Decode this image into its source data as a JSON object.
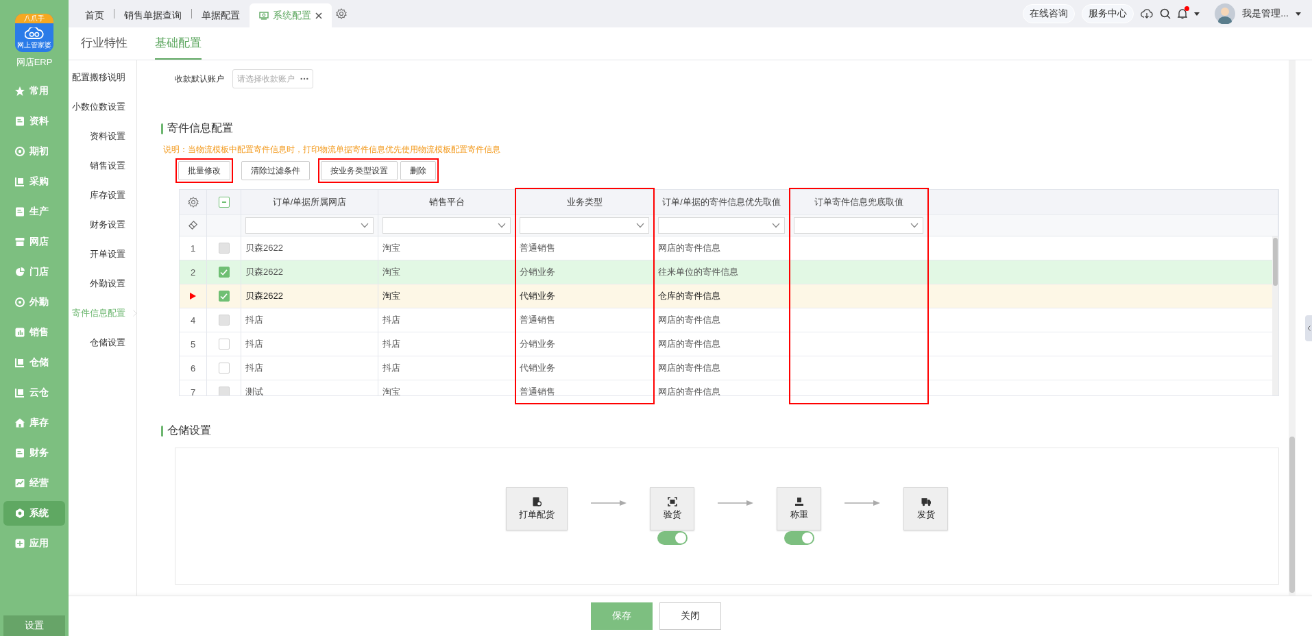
{
  "app": {
    "logo_badge": "八爪手",
    "logo_caption": "网上管家婆",
    "name": "网店ERP"
  },
  "nav": [
    {
      "label": "常用",
      "selected": false
    },
    {
      "label": "资料",
      "selected": false
    },
    {
      "label": "期初",
      "selected": false
    },
    {
      "label": "采购",
      "selected": false
    },
    {
      "label": "生产",
      "selected": false
    },
    {
      "label": "网店",
      "selected": false
    },
    {
      "label": "门店",
      "selected": false
    },
    {
      "label": "外勤",
      "selected": false
    },
    {
      "label": "销售",
      "selected": false
    },
    {
      "label": "仓储",
      "selected": false
    },
    {
      "label": "云仓",
      "selected": false
    },
    {
      "label": "库存",
      "selected": false
    },
    {
      "label": "财务",
      "selected": false
    },
    {
      "label": "经营",
      "selected": false
    },
    {
      "label": "系统",
      "selected": true
    },
    {
      "label": "应用",
      "selected": false
    }
  ],
  "settings_button": "设置",
  "tabs": [
    {
      "label": "首页",
      "selected": false
    },
    {
      "label": "销售单据查询",
      "selected": false
    },
    {
      "label": "单据配置",
      "selected": false
    },
    {
      "label": "系统配置",
      "selected": true
    }
  ],
  "header": {
    "buttons": [
      "在线咨询",
      "服务中心"
    ],
    "has_notification": true,
    "user": "我是管理..."
  },
  "subtabs": [
    {
      "label": "行业特性",
      "selected": false
    },
    {
      "label": "基础配置",
      "selected": true
    }
  ],
  "section_nav": [
    {
      "label": "配置搬移说明",
      "selected": false
    },
    {
      "label": "小数位数设置",
      "selected": false
    },
    {
      "label": "资料设置",
      "selected": false
    },
    {
      "label": "销售设置",
      "selected": false
    },
    {
      "label": "库存设置",
      "selected": false
    },
    {
      "label": "财务设置",
      "selected": false
    },
    {
      "label": "开单设置",
      "selected": false
    },
    {
      "label": "外勤设置",
      "selected": false
    },
    {
      "label": "寄件信息配置",
      "selected": true
    },
    {
      "label": "仓储设置",
      "selected": false
    }
  ],
  "account_field": {
    "label": "收款默认账户",
    "placeholder": "请选择收款账户"
  },
  "shipping": {
    "title": "寄件信息配置",
    "note": "说明：当物流模板中配置寄件信息时，打印物流单据寄件信息优先使用物流模板配置寄件信息",
    "button_groups": [
      {
        "highlighted": true,
        "buttons": [
          "批量修改"
        ]
      },
      {
        "highlighted": false,
        "buttons": [
          "清除过滤条件"
        ]
      },
      {
        "highlighted": true,
        "buttons": [
          "按业务类型设置",
          "删除"
        ]
      }
    ],
    "select_all": {
      "partial": true
    },
    "columns": [
      {
        "label": "订单/单据所属网店",
        "highlighted": false
      },
      {
        "label": "销售平台",
        "highlighted": false
      },
      {
        "label": "业务类型",
        "highlighted": true
      },
      {
        "label": "订单/单据的寄件信息优先取值",
        "highlighted": false
      },
      {
        "label": "订单寄件信息兜底取值",
        "highlighted": true
      }
    ],
    "rows": [
      {
        "index": "1",
        "current": false,
        "checked": false,
        "disabled": true,
        "cells": [
          "贝森2622",
          "淘宝",
          "普通销售",
          "网店的寄件信息"
        ]
      },
      {
        "index": "2",
        "current": false,
        "checked": true,
        "disabled": false,
        "cells": [
          "贝森2622",
          "淘宝",
          "分销业务",
          "往来单位的寄件信息"
        ]
      },
      {
        "current": true,
        "checked": true,
        "disabled": false,
        "cells": [
          "贝森2622",
          "淘宝",
          "代销业务",
          "仓库的寄件信息"
        ]
      },
      {
        "index": "4",
        "current": false,
        "checked": false,
        "disabled": true,
        "cells": [
          "抖店",
          "抖店",
          "普通销售",
          "网店的寄件信息"
        ]
      },
      {
        "index": "5",
        "current": false,
        "checked": false,
        "disabled": false,
        "cells": [
          "抖店",
          "抖店",
          "分销业务",
          "网店的寄件信息"
        ]
      },
      {
        "index": "6",
        "current": false,
        "checked": false,
        "disabled": false,
        "cells": [
          "抖店",
          "抖店",
          "代销业务",
          "网店的寄件信息"
        ]
      },
      {
        "index": "7",
        "current": false,
        "checked": false,
        "disabled": true,
        "cells": [
          "测试",
          "淘宝",
          "普通销售",
          "网店的寄件信息"
        ]
      }
    ]
  },
  "storage": {
    "title": "仓储设置",
    "steps": [
      {
        "label": "打单配货",
        "kind": "fixed"
      },
      {
        "label": "验货",
        "kind": "optional",
        "on": true
      },
      {
        "label": "称重",
        "kind": "optional",
        "on": true
      },
      {
        "label": "发货",
        "kind": "fixed"
      }
    ]
  },
  "footer": {
    "buttons": [
      {
        "label": "保存",
        "kind": "primary"
      },
      {
        "label": "关闭",
        "kind": "default"
      }
    ]
  }
}
